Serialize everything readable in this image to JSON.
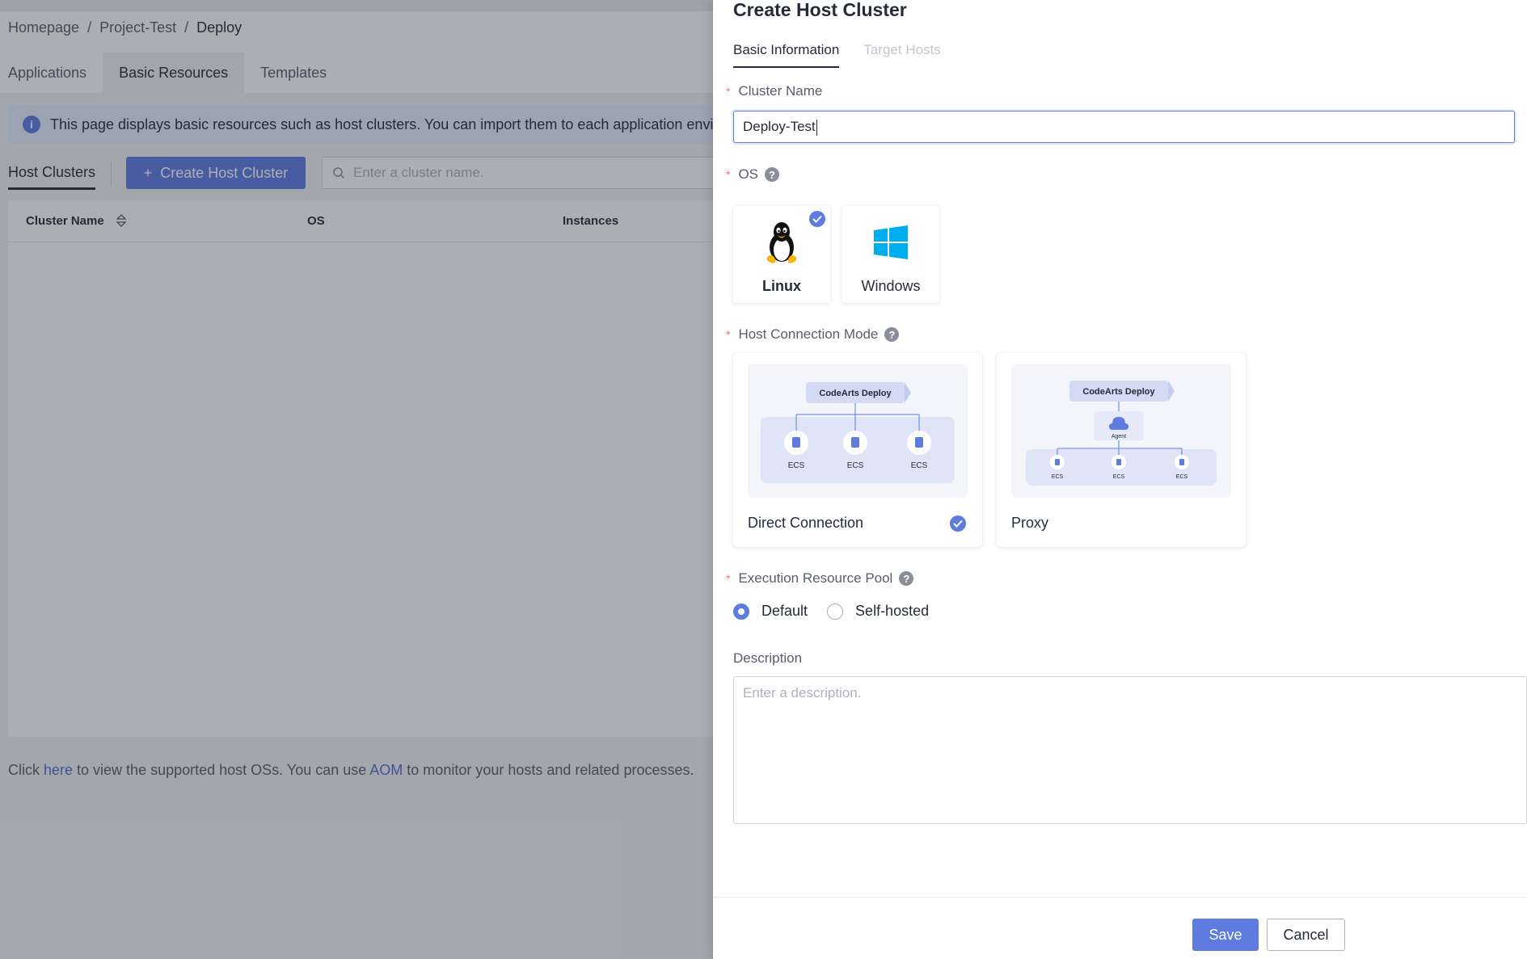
{
  "background": {
    "breadcrumb": [
      "Homepage",
      "Project-Test",
      "Deploy"
    ],
    "tabs": [
      "Applications",
      "Basic Resources",
      "Templates"
    ],
    "notice": "This page displays basic resources such as host clusters. You can import them to each application environ",
    "sub_tab": "Host Clusters",
    "create_button": "Create Host Cluster",
    "search_placeholder": "Enter a cluster name.",
    "table_headers": [
      "Cluster Name",
      "OS",
      "Instances"
    ],
    "footnote": {
      "part1": "Click ",
      "link1": "here",
      "part2": " to view the supported host OSs. You can use ",
      "link2": "AOM",
      "part3": " to monitor your hosts and related processes."
    }
  },
  "drawer": {
    "title": "Create Host Cluster",
    "tabs": [
      "Basic Information",
      "Target Hosts"
    ],
    "cluster_name_label": "Cluster Name",
    "cluster_name_value": "Deploy-Test",
    "os_label": "OS",
    "os_options": [
      {
        "label": "Linux",
        "selected": true
      },
      {
        "label": "Windows",
        "selected": false
      }
    ],
    "mode_label": "Host Connection Mode",
    "modes": [
      {
        "label": "Direct Connection",
        "selected": true,
        "diagram_title": "CodeArts Deploy",
        "nodes": [
          "ECS",
          "ECS",
          "ECS"
        ]
      },
      {
        "label": "Proxy",
        "selected": false,
        "diagram_title": "CodeArts Deploy",
        "agent": "Agent",
        "nodes": [
          "ECS",
          "ECS",
          "ECS"
        ]
      }
    ],
    "pool_label": "Execution Resource Pool",
    "pool_options": [
      {
        "label": "Default",
        "selected": true
      },
      {
        "label": "Self-hosted",
        "selected": false
      }
    ],
    "description_label": "Description",
    "description_placeholder": "Enter a description.",
    "save_label": "Save",
    "cancel_label": "Cancel"
  },
  "colors": {
    "accent": "#5e7ce0",
    "required": "#f66f6a",
    "windows_blue": "#00adef"
  },
  "help_icon": "?"
}
